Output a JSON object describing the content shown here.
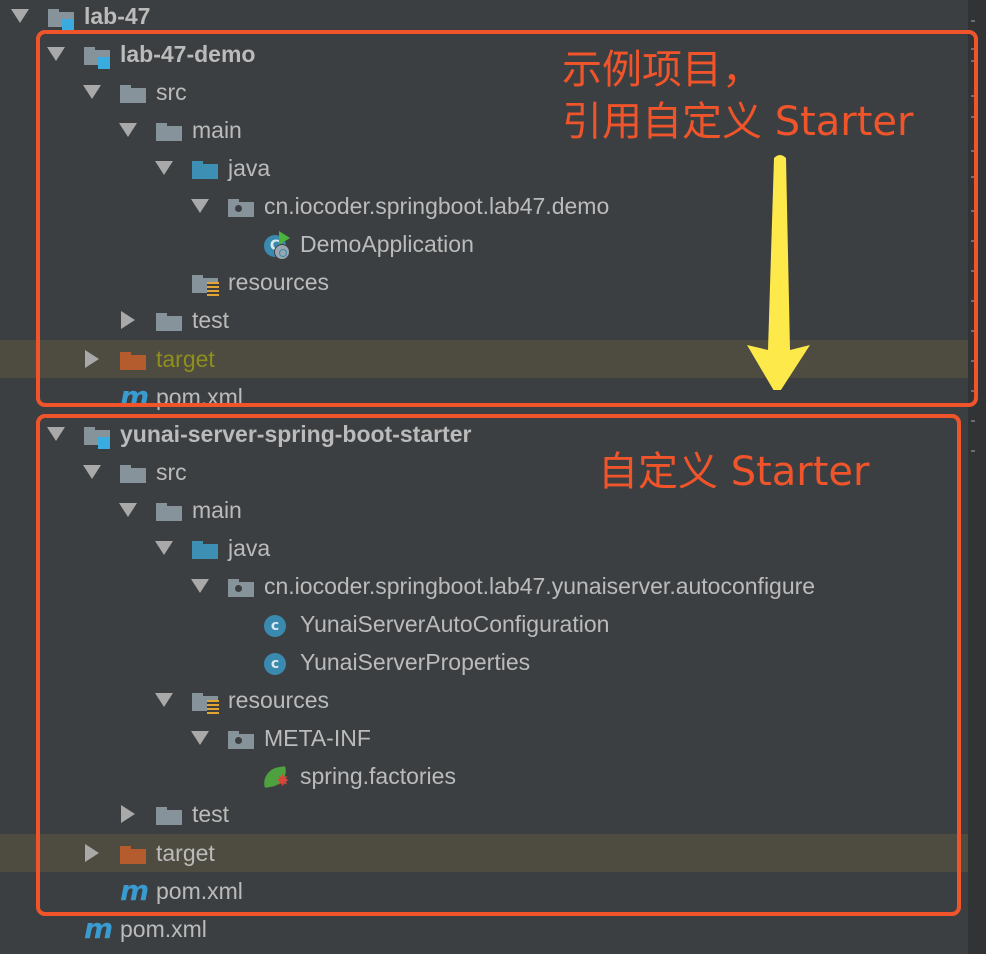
{
  "tree": {
    "rows": [
      {
        "label": "lab-47",
        "icon": "module-folder",
        "arrow": "down",
        "bold": true
      },
      {
        "label": "lab-47-demo",
        "icon": "module-folder",
        "arrow": "down",
        "bold": true
      },
      {
        "label": "src",
        "icon": "folder",
        "arrow": "down"
      },
      {
        "label": "main",
        "icon": "folder",
        "arrow": "down"
      },
      {
        "label": "java",
        "icon": "source-folder",
        "arrow": "down"
      },
      {
        "label": "cn.iocoder.springboot.lab47.demo",
        "icon": "package",
        "arrow": "down"
      },
      {
        "label": "DemoApplication",
        "icon": "spring-boot-app-class"
      },
      {
        "label": "resources",
        "icon": "resources-folder"
      },
      {
        "label": "test",
        "icon": "folder",
        "arrow": "right"
      },
      {
        "label": "target",
        "icon": "excluded-folder",
        "arrow": "right",
        "highlighted": true,
        "color": "olive"
      },
      {
        "label": "pom.xml",
        "icon": "maven-file"
      },
      {
        "label": "yunai-server-spring-boot-starter",
        "icon": "module-folder",
        "arrow": "down",
        "bold": true
      },
      {
        "label": "src",
        "icon": "folder",
        "arrow": "down"
      },
      {
        "label": "main",
        "icon": "folder",
        "arrow": "down"
      },
      {
        "label": "java",
        "icon": "source-folder",
        "arrow": "down"
      },
      {
        "label": "cn.iocoder.springboot.lab47.yunaiserver.autoconfigure",
        "icon": "package",
        "arrow": "down"
      },
      {
        "label": "YunaiServerAutoConfiguration",
        "icon": "class"
      },
      {
        "label": "YunaiServerProperties",
        "icon": "class"
      },
      {
        "label": "resources",
        "icon": "resources-folder",
        "arrow": "down"
      },
      {
        "label": "META-INF",
        "icon": "package",
        "arrow": "down"
      },
      {
        "label": "spring.factories",
        "icon": "spring-factories-file"
      },
      {
        "label": "test",
        "icon": "folder",
        "arrow": "right"
      },
      {
        "label": "target",
        "icon": "excluded-folder",
        "arrow": "right",
        "highlighted": true
      },
      {
        "label": "pom.xml",
        "icon": "maven-file"
      },
      {
        "label": "pom.xml",
        "icon": "maven-file"
      }
    ]
  },
  "annotations": {
    "demo_note_line1": "示例项目，",
    "demo_note_line2": "引用自定义 Starter",
    "starter_note": "自定义 Starter",
    "box_color": "#f0542a",
    "arrow_color": "#fdea4a"
  }
}
